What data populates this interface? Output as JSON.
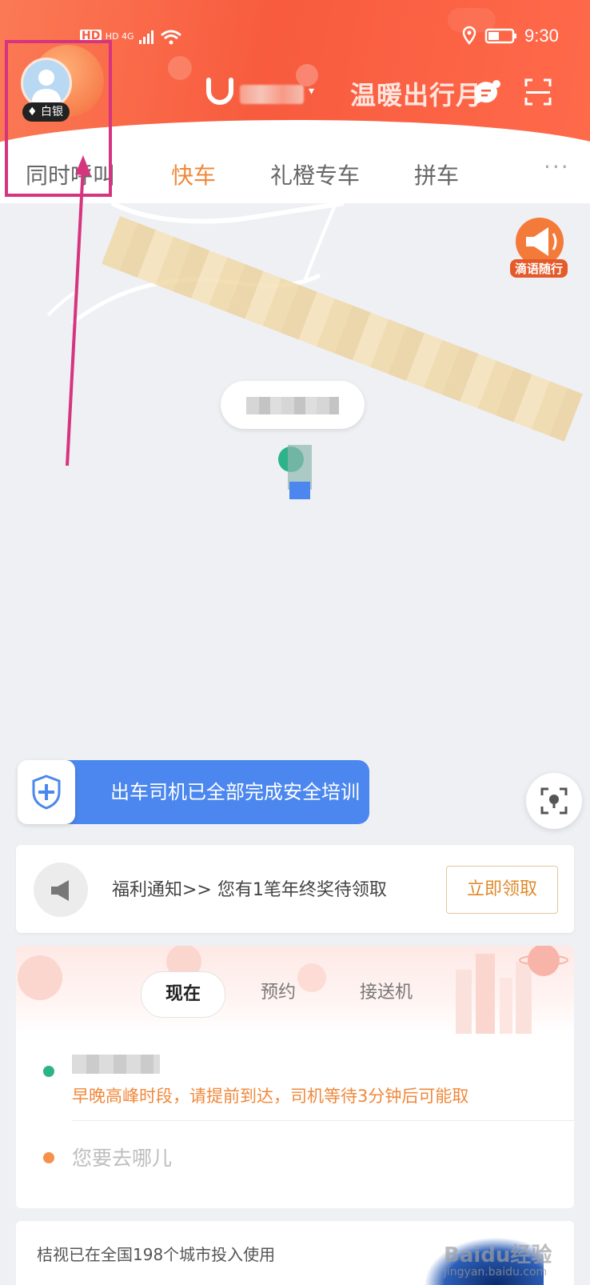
{
  "status_bar": {
    "network": "HD 4G",
    "time": "9:30"
  },
  "header": {
    "title": "温暖出行月",
    "member_badge": "白银"
  },
  "tabs": [
    {
      "label": "同时呼叫"
    },
    {
      "label": "快车"
    },
    {
      "label": "礼橙专车"
    },
    {
      "label": "拼车"
    },
    {
      "label": "···"
    }
  ],
  "map": {
    "speaker_label": "滴语随行"
  },
  "safety_banner": {
    "text": "出车司机已全部完成安全培训"
  },
  "notice": {
    "text": "福利通知>> 您有1笔年终奖待领取",
    "button": "立即领取"
  },
  "booking": {
    "tabs": [
      "现在",
      "预约",
      "接送机"
    ],
    "from_hint": "早晚高峰时段，请提前到达，司机等待3分钟后可能取",
    "to_placeholder": "您要去哪儿"
  },
  "footer": {
    "text": "桔视已在全国198个城市投入使用",
    "watermark": "Baidu经验",
    "watermark_sub": "jingyan.baidu.com"
  },
  "colors": {
    "accent": "#f0883b",
    "header": "#f85b3e",
    "banner": "#4b87ee",
    "highlight": "#d6347f"
  }
}
